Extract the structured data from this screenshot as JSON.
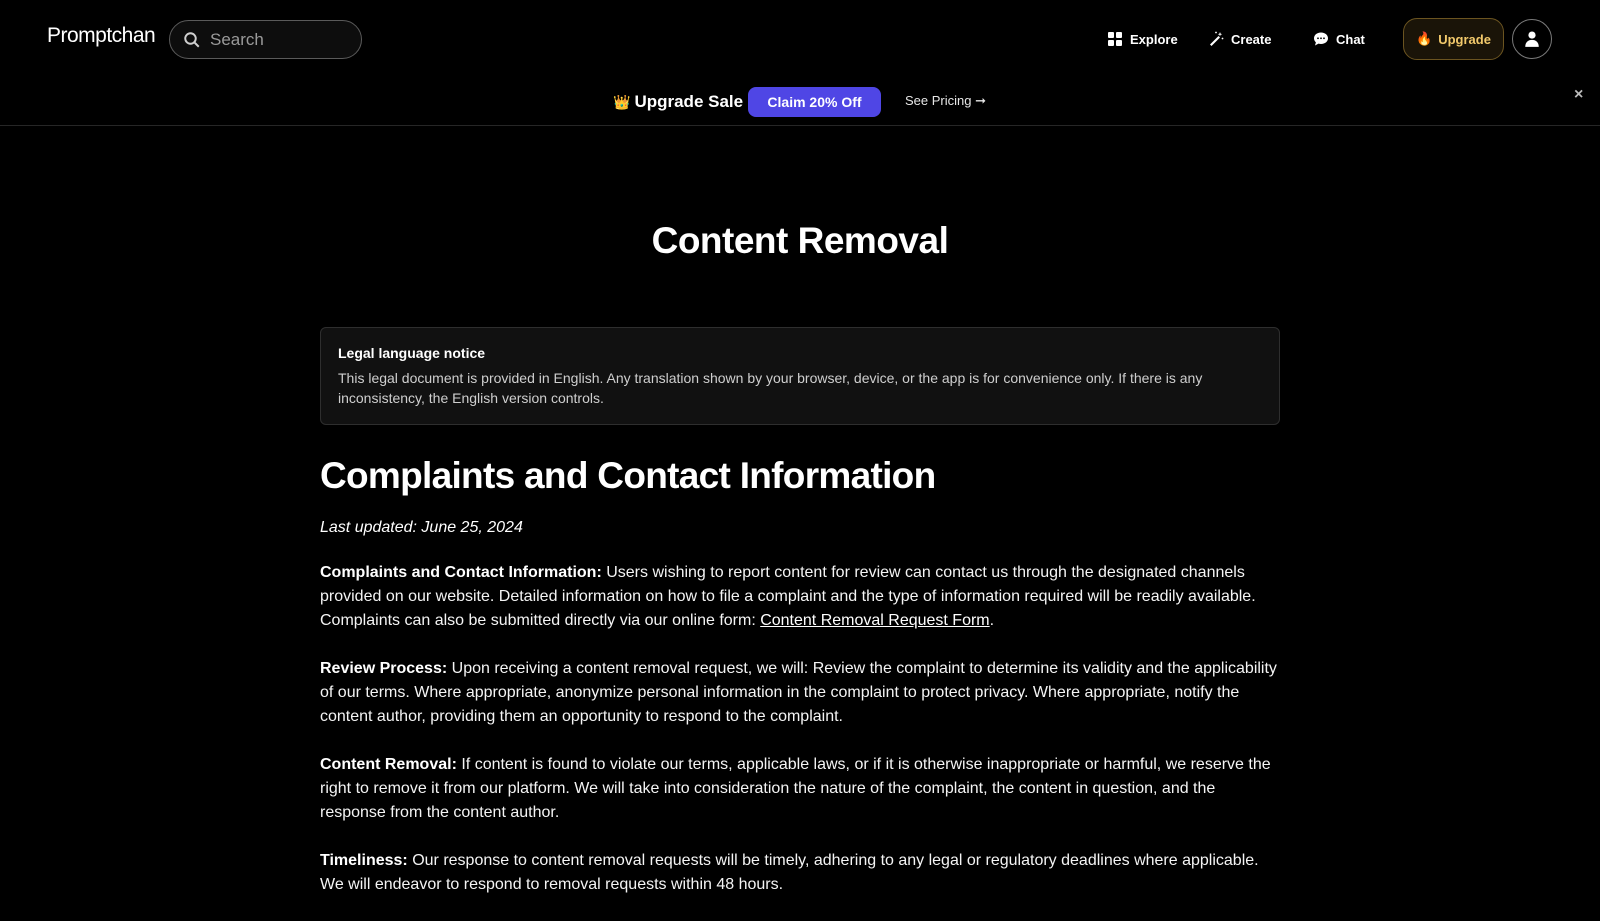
{
  "header": {
    "logo": "Promptchan",
    "search_placeholder": "Search",
    "nav": {
      "explore": "Explore",
      "create": "Create",
      "chat": "Chat"
    },
    "upgrade_label": "Upgrade",
    "upgrade_emoji": "🔥",
    "accent": "#f2c96b"
  },
  "banner": {
    "emoji": "👑",
    "title": "Upgrade Sale",
    "claim_label": "Claim 20% Off",
    "claim_color": "#4f46e5",
    "see_pricing": "See Pricing ➞",
    "close": "×"
  },
  "page": {
    "title": "Content Removal"
  },
  "notice": {
    "title": "Legal language notice",
    "body": "This legal document is provided in English. Any translation shown by your browser, device, or the app is for convenience only. If there is any inconsistency, the English version controls."
  },
  "content": {
    "heading": "Complaints and Contact Information",
    "last_updated": "Last updated: June 25, 2024",
    "sections": [
      {
        "label": "Complaints and Contact Information:",
        "text": " Users wishing to report content for review can contact us through the designated channels provided on our website. Detailed information on how to file a complaint and the type of information required will be readily available. Complaints can also be submitted directly via our online form: ",
        "link": "Content Removal Request Form",
        "after": "."
      },
      {
        "label": "Review Process:",
        "text": " Upon receiving a content removal request, we will: Review the complaint to determine its validity and the applicability of our terms. Where appropriate, anonymize personal information in the complaint to protect privacy. Where appropriate, notify the content author, providing them an opportunity to respond to the complaint."
      },
      {
        "label": "Content Removal:",
        "text": " If content is found to violate our terms, applicable laws, or if it is otherwise inappropriate or harmful, we reserve the right to remove it from our platform. We will take into consideration the nature of the complaint, the content in question, and the response from the content author."
      },
      {
        "label": "Timeliness:",
        "text": " Our response to content removal requests will be timely, adhering to any legal or regulatory deadlines where applicable. We will endeavor to respond to removal requests within 48 hours."
      }
    ]
  }
}
